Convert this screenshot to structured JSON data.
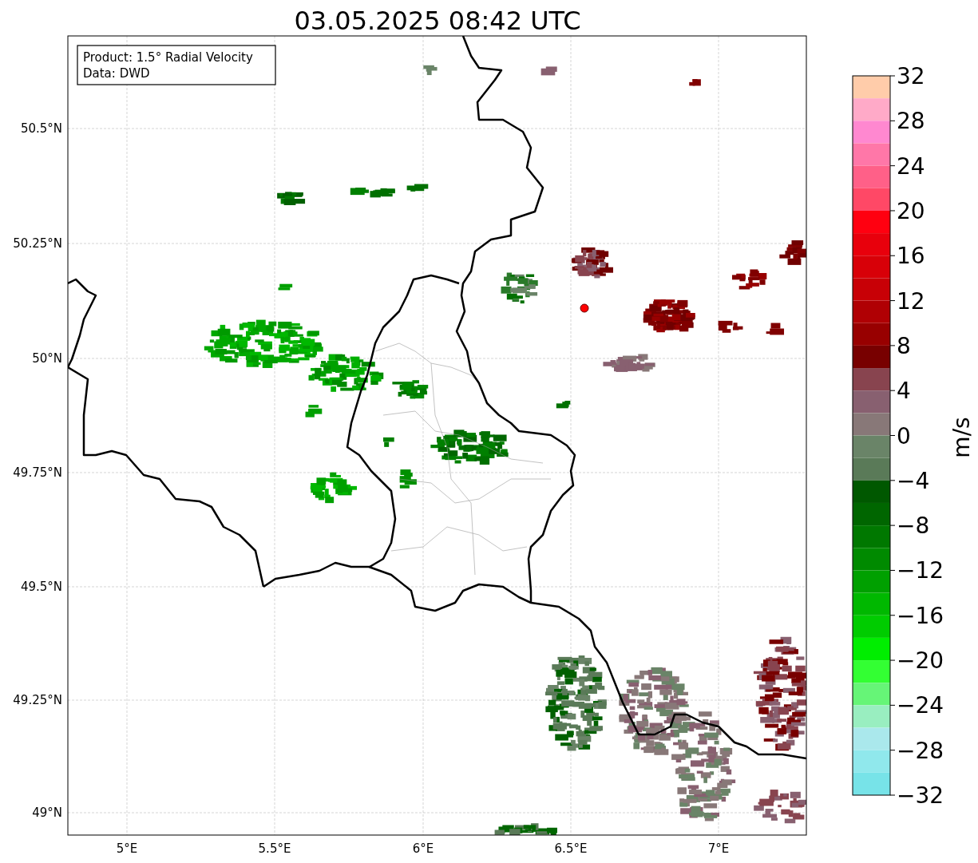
{
  "title": "03.05.2025 08:42 UTC",
  "info_box": {
    "lines": [
      "Product: 1.5° Radial Velocity",
      "Data: DWD"
    ]
  },
  "map": {
    "lon_ticks": [
      "5°E",
      "5.5°E",
      "6°E",
      "6.5°E",
      "7°E"
    ],
    "lat_ticks": [
      "50.5°N",
      "50.25°N",
      "50°N",
      "49.75°N",
      "49.5°N",
      "49.25°N",
      "49°N"
    ]
  },
  "colorbar": {
    "label": "m/s",
    "ticks": [
      "32",
      "28",
      "24",
      "20",
      "16",
      "12",
      "8",
      "4",
      "0",
      "−4",
      "−8",
      "−12",
      "−16",
      "−20",
      "−24",
      "−28",
      "−32"
    ],
    "bands": [
      {
        "color": "#ffccaa"
      },
      {
        "color": "#ffaac8"
      },
      {
        "color": "#ff88d0"
      },
      {
        "color": "#ff77a8"
      },
      {
        "color": "#ff6088"
      },
      {
        "color": "#ff4866"
      },
      {
        "color": "#ff0010"
      },
      {
        "color": "#e8000c"
      },
      {
        "color": "#d80008"
      },
      {
        "color": "#c80006"
      },
      {
        "color": "#b00004"
      },
      {
        "color": "#980000"
      },
      {
        "color": "#780000"
      },
      {
        "color": "#88444f"
      },
      {
        "color": "#886070"
      },
      {
        "color": "#887878"
      },
      {
        "color": "#6a8468"
      },
      {
        "color": "#5a7a58"
      },
      {
        "color": "#005800"
      },
      {
        "color": "#006600"
      },
      {
        "color": "#007800"
      },
      {
        "color": "#008a00"
      },
      {
        "color": "#00a000"
      },
      {
        "color": "#00b800"
      },
      {
        "color": "#00cc00"
      },
      {
        "color": "#00ee00"
      },
      {
        "color": "#33ff33"
      },
      {
        "color": "#66f577"
      },
      {
        "color": "#99eec0"
      },
      {
        "color": "#aae8ec"
      },
      {
        "color": "#90e8ec"
      },
      {
        "color": "#77e3e8"
      }
    ]
  }
}
